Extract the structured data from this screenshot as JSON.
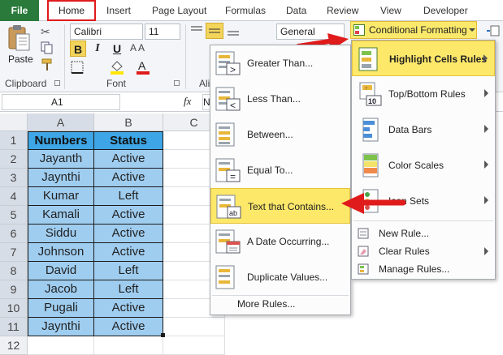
{
  "ribbon": {
    "tabs": [
      "File",
      "Home",
      "Insert",
      "Page Layout",
      "Formulas",
      "Data",
      "Review",
      "View",
      "Developer"
    ],
    "clipboard": {
      "paste_label": "Paste",
      "group_label": "Clipboard"
    },
    "font": {
      "name": "Calibri",
      "size": "11",
      "group_label": "Font",
      "bold": "B",
      "italic": "I",
      "underline": "U"
    },
    "alignment": {
      "group_label": "Ali"
    },
    "number_format": "General",
    "conditional_formatting_label": "Conditional Formatting"
  },
  "formula_bar": {
    "name_box": "A1",
    "fx": "fx",
    "content": "N"
  },
  "columns": [
    "A",
    "B",
    "C"
  ],
  "rows": [
    "1",
    "2",
    "3",
    "4",
    "5",
    "6",
    "7",
    "8",
    "9",
    "10",
    "11",
    "12"
  ],
  "table": {
    "headers": [
      "Numbers",
      "Status"
    ],
    "rows": [
      [
        "Jayanth",
        "Active"
      ],
      [
        "Jaynthi",
        "Active"
      ],
      [
        "Kumar",
        "Left"
      ],
      [
        "Kamali",
        "Active"
      ],
      [
        "Siddu",
        "Active"
      ],
      [
        "Johnson",
        "Active"
      ],
      [
        "David",
        "Left"
      ],
      [
        "Jacob",
        "Left"
      ],
      [
        "Pugali",
        "Active"
      ],
      [
        "Jaynthi",
        "Active"
      ]
    ]
  },
  "cf_menu": {
    "items": [
      "Highlight Cells Rules",
      "Top/Bottom Rules",
      "Data Bars",
      "Color Scales",
      "Icon Sets"
    ],
    "small_items": [
      "New Rule...",
      "Clear Rules",
      "Manage Rules..."
    ]
  },
  "highlight_submenu": {
    "items": [
      "Greater Than...",
      "Less Than...",
      "Between...",
      "Equal To...",
      "Text that Contains...",
      "A Date Occurring...",
      "Duplicate Values..."
    ],
    "more": "More Rules..."
  },
  "colors": {
    "accent_red": "#e01b1b",
    "highlight_yellow": "#fde86a",
    "header_blue": "#3ea6e6",
    "cell_blue": "#9fcdf0",
    "file_green": "#2a7a3b"
  }
}
